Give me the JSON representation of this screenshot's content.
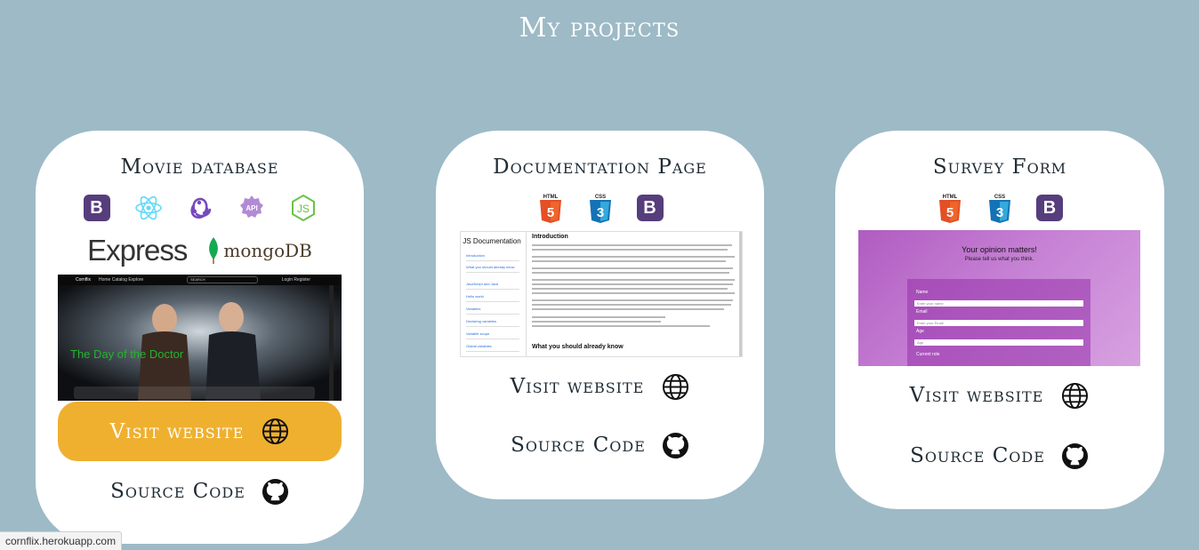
{
  "page": {
    "title": "My projects"
  },
  "projects": [
    {
      "title": "Movie database",
      "tech_row1": [
        "Bootstrap",
        "React",
        "Redux",
        "API",
        "Node.js"
      ],
      "tech_row2": [
        "Express",
        "mongoDB"
      ],
      "bootstrap_glyph": "B",
      "express_label": "Express",
      "mongo_label": "mongoDB",
      "preview": {
        "nav_brand": "Cornflix",
        "nav_links": "Home   Catalog   Explore",
        "nav_search": "SEARCH",
        "nav_right": "Login   Register",
        "caption": "The Day of the Doctor"
      },
      "visit_label": "Visit website",
      "source_label": "Source Code"
    },
    {
      "title": "Documentation Page",
      "tech": [
        "HTML5",
        "CSS3",
        "Bootstrap"
      ],
      "html_badge": "HTML",
      "css_badge": "CSS",
      "bootstrap_glyph": "B",
      "preview": {
        "sidebar_title": "JS Documentation",
        "sidebar_links": [
          "Introduction",
          "What you should already know",
          "JavaScript and Java",
          "Hello world",
          "Variables",
          "Declaring variables",
          "Variable scope",
          "Global variables"
        ],
        "heading": "Introduction",
        "heading2": "What you should already know"
      },
      "visit_label": "Visit website",
      "source_label": "Source Code"
    },
    {
      "title": "Survey Form",
      "tech": [
        "HTML5",
        "CSS3",
        "Bootstrap"
      ],
      "html_badge": "HTML",
      "css_badge": "CSS",
      "bootstrap_glyph": "B",
      "preview": {
        "heading": "Your opinion matters!",
        "subheading": "Please tell us what you think.",
        "fields": [
          "Name",
          "Email",
          "Age",
          "Current role"
        ],
        "name_placeholder": "Enter your name",
        "email_placeholder": "Enter your Email",
        "age_placeholder": "Age"
      },
      "visit_label": "Visit website",
      "source_label": "Source Code"
    }
  ],
  "status_bar": {
    "url": "cornflix.herokuapp.com"
  },
  "colors": {
    "background": "#9dbac6",
    "accent": "#efb02f",
    "card": "#ffffff"
  }
}
